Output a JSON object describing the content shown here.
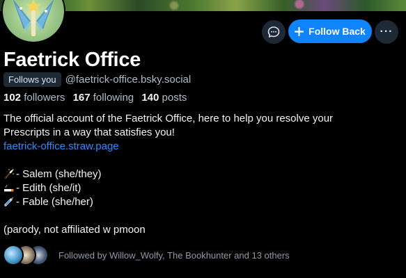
{
  "profile": {
    "display_name": "Faetrick Office",
    "follows_you_badge": "Follows you",
    "handle": "@faetrick-office.bsky.social",
    "avatar_icon": "fairy-wand-icon"
  },
  "actions": {
    "message_icon": "chat-bubble-icon",
    "follow_back_icon": "plus-icon",
    "follow_back_label": "Follow Back",
    "more_icon": "ellipsis-icon",
    "more_label": "···"
  },
  "stats": {
    "followers_count": "102",
    "followers_label": "followers",
    "following_count": "167",
    "following_label": "following",
    "posts_count": "140",
    "posts_label": "posts"
  },
  "bio": {
    "line1": "The official account of the Faetrick Office, here to help you resolve your",
    "line2": "Prescripts in a way that satisfies you!",
    "link": "faetrick-office.straw.page",
    "members": [
      {
        "icon": "magic-wand-icon",
        "text": "- Salem (she/they)"
      },
      {
        "icon": "cigarette-icon",
        "text": "- Edith (she/it)"
      },
      {
        "icon": "syringe-icon",
        "text": "- Fable (she/her)"
      }
    ],
    "note": "(parody, not affiliated w pmoon"
  },
  "followed_by": {
    "text": "Followed by Willow_Wolfy, The Bookhunter and 13 others"
  },
  "colors": {
    "background": "#000000",
    "accent": "#1083fe",
    "link": "#2f8cff",
    "muted_text": "#aebbc9",
    "button_dark": "#1e2936"
  }
}
